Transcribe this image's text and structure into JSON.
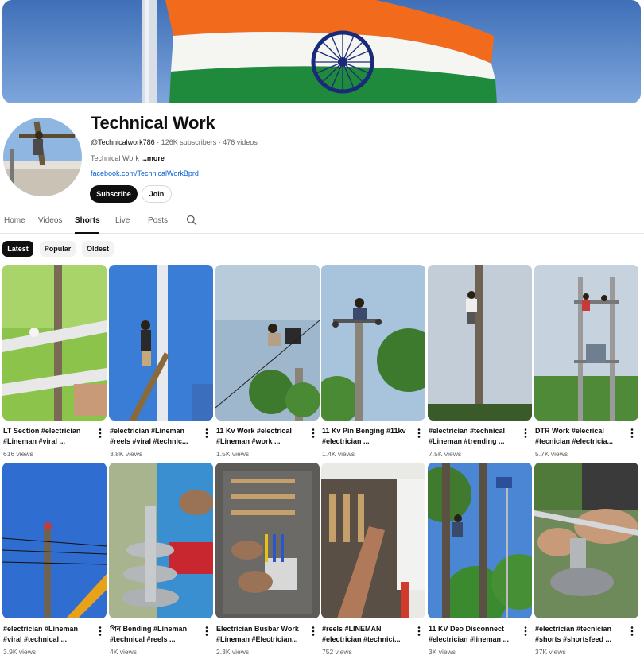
{
  "channel": {
    "name": "Technical Work",
    "handle": "@Technicalwork786",
    "stats": " · 126K subscribers · 476 videos",
    "description": "Technical Work",
    "more_label": " ...more",
    "link": "facebook.com/TechnicalWorkBprd",
    "subscribe_label": "Subscribe",
    "join_label": "Join"
  },
  "tabs": [
    {
      "label": "Home"
    },
    {
      "label": "Videos"
    },
    {
      "label": "Shorts"
    },
    {
      "label": "Live"
    },
    {
      "label": "Posts"
    }
  ],
  "active_tab": "Shorts",
  "chips": [
    {
      "label": "Latest"
    },
    {
      "label": "Popular"
    },
    {
      "label": "Oldest"
    }
  ],
  "shorts": [
    {
      "title": "LT Section #electrician #Lineman  #viral ...",
      "views": "616 views"
    },
    {
      "title": "#electrician #Lineman #reels #viral #technic...",
      "views": "3.8K views"
    },
    {
      "title": "11 Kv Work #electrical #Lineman #work ...",
      "views": "1.5K views"
    },
    {
      "title": "11 Kv Pin Benging #11kv #electrician ...",
      "views": "1.4K views"
    },
    {
      "title": "#electrician #technical #Lineman #trending ...",
      "views": "7.5K views"
    },
    {
      "title": "DTR Work #elecrical #tecnician #electricia...",
      "views": "5.7K views"
    },
    {
      "title": "#electrician #Lineman #viral #technical ...",
      "views": "3.9K views"
    },
    {
      "title": "পিন Bending #Lineman #technical #reels ...",
      "views": "4K views"
    },
    {
      "title": "Electrician Busbar Work #Lineman #Electrician...",
      "views": "2.3K views"
    },
    {
      "title": "#reels #LINEMAN #electrician #technici...",
      "views": "752 views"
    },
    {
      "title": "11 KV Deo Disconnect #electrician #lineman ...",
      "views": "3K views"
    },
    {
      "title": "#electrician #tecnician #shorts #shortsfeed ...",
      "views": "37K views"
    }
  ],
  "colors": {
    "saffron": "#f26b1d",
    "green": "#1f8a3b",
    "chakra": "#1a2a7a",
    "link": "#065fd4",
    "sky": "#5b8fd6"
  },
  "icons": {
    "search": "search-icon",
    "more": "more-vert-icon"
  }
}
